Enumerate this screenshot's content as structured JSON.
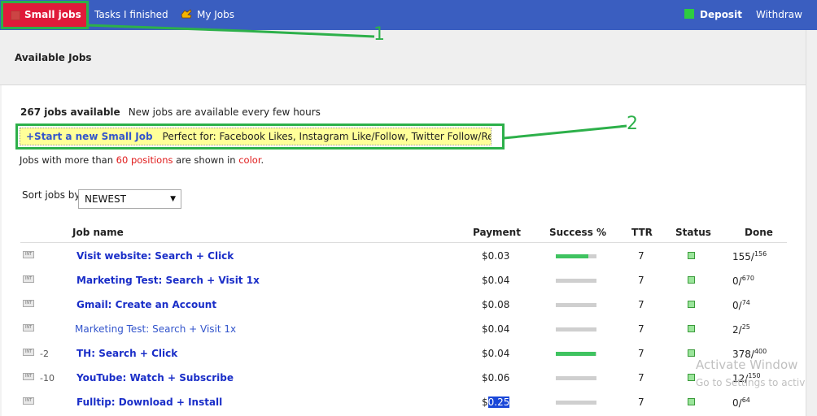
{
  "nav": {
    "small_jobs": "Small jobs",
    "tasks_finished": "Tasks I finished",
    "my_jobs": "My Jobs",
    "deposit": "Deposit",
    "withdraw": "Withdraw"
  },
  "page_title": "Available Jobs",
  "summary": {
    "count": "267 jobs available",
    "note": "New jobs are available every few hours"
  },
  "start_job": {
    "link": "+Start a new Small Job",
    "desc": "Perfect for: Facebook Likes, Instagram Like/Follow, Twitter Follow/Retweet,..."
  },
  "positions_note": {
    "prefix": "Jobs with more than ",
    "count": "60 positions",
    "middle": " are shown in ",
    "color_word": "color",
    "suffix": "."
  },
  "sort": {
    "label": "Sort jobs by",
    "value": "NEWEST"
  },
  "table": {
    "headers": {
      "name": "Job name",
      "payment": "Payment",
      "success": "Success %",
      "ttr": "TTR",
      "status": "Status",
      "done": "Done"
    },
    "rows": [
      {
        "badge": "INT",
        "adj": "",
        "name": "Visit website: Search + Click",
        "payment": "$0.03",
        "success": 0.8,
        "ttr": "7",
        "done": "155/",
        "total": "156"
      },
      {
        "badge": "INT",
        "adj": "",
        "name": "Marketing Test: Search + Visit 1x",
        "payment": "$0.04",
        "success": 0,
        "ttr": "7",
        "done": "0/",
        "total": "670"
      },
      {
        "badge": "INT",
        "adj": "",
        "name": "Gmail: Create an Account",
        "payment": "$0.08",
        "success": 0,
        "ttr": "7",
        "done": "0/",
        "total": "74"
      },
      {
        "badge": "INT",
        "adj": "",
        "name": "Marketing Test: Search + Visit 1x",
        "payment": "$0.04",
        "success": 0,
        "ttr": "7",
        "done": "2/",
        "total": "25"
      },
      {
        "badge": "INT",
        "adj": "-2",
        "name": "TH: Search + Click",
        "payment": "$0.04",
        "success": 0.98,
        "ttr": "7",
        "done": "378/",
        "total": "400"
      },
      {
        "badge": "INT",
        "adj": "-10",
        "name": "YouTube: Watch + Subscribe",
        "payment": "$0.06",
        "success": 0,
        "ttr": "7",
        "done": "12/",
        "total": "150"
      },
      {
        "badge": "INT",
        "adj": "",
        "name": "Fulltip: Download + Install",
        "payment_prefix": "$",
        "payment_selected": "0.25",
        "success": 0,
        "ttr": "7",
        "done": "0/",
        "total": "64"
      }
    ]
  },
  "annotations": {
    "one": "1",
    "two": "2"
  },
  "watermark": {
    "line1": "Activate Window",
    "line2": "Go to Settings to activ"
  },
  "colors": {
    "nav_bg": "#3a5ec0",
    "active_tab": "#e01a3a",
    "annotation_green": "#2db04a",
    "link_blue": "#1a2ec8",
    "success_fill": "#3fc360"
  }
}
